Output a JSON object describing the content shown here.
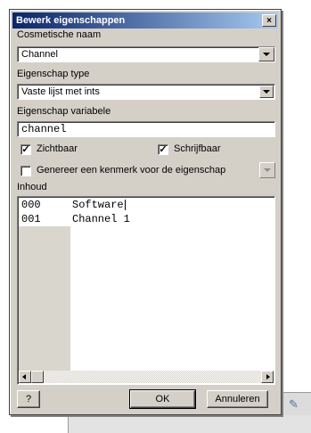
{
  "dialog": {
    "title": "Bewerk eigenschappen",
    "close_glyph": "×"
  },
  "fields": {
    "cosmetic_name_label": "Cosmetische naam",
    "cosmetic_name_value": "Channel",
    "property_type_label": "Eigenschap type",
    "property_type_value": "Vaste lijst met ints",
    "property_variable_label": "Eigenschap variabele",
    "property_variable_value": "channel"
  },
  "checkboxes": {
    "visible_label": "Zichtbaar",
    "visible_checked": true,
    "writable_label": "Schrijfbaar",
    "writable_checked": true,
    "generate_label": "Genereer een kenmerk voor de eigenschap",
    "generate_checked": false,
    "check_glyph": "✓"
  },
  "content": {
    "label": "Inhoud",
    "rows": [
      {
        "id": "000",
        "name": "Software"
      },
      {
        "id": "001",
        "name": "Channel 1"
      }
    ]
  },
  "buttons": {
    "help": "?",
    "ok": "OK",
    "cancel": "Annuleren"
  },
  "icons": {
    "pencil": "✎"
  }
}
